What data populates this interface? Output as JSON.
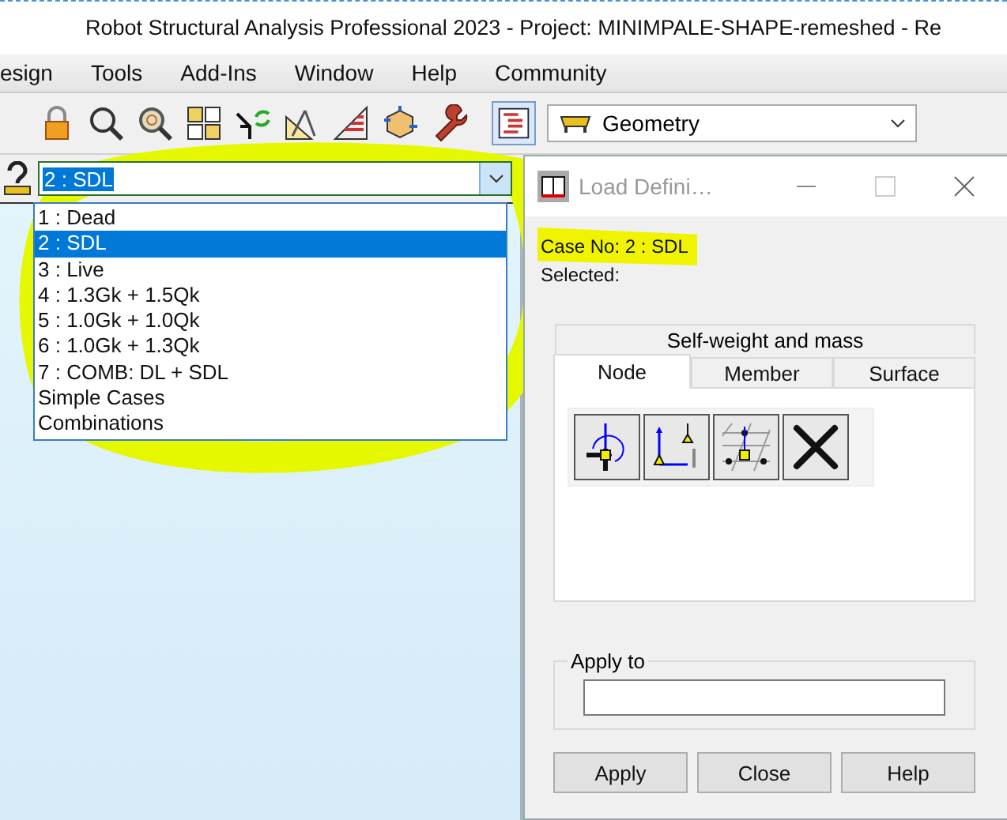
{
  "window": {
    "title": "Robot Structural Analysis Professional 2023 - Project: MINIMPALE-SHAPE-remeshed - Re"
  },
  "menu": [
    "esign",
    "Tools",
    "Add-Ins",
    "Window",
    "Help",
    "Community"
  ],
  "toolbar": {
    "layout_combo": "Geometry"
  },
  "load_case_combo": {
    "value": "2 : SDL",
    "options": [
      {
        "label": "1 : Dead",
        "selected": false
      },
      {
        "label": "2 : SDL",
        "selected": true
      },
      {
        "label": "3 : Live",
        "selected": false
      },
      {
        "label": "4 : 1.3Gk + 1.5Qk",
        "selected": false
      },
      {
        "label": "5 : 1.0Gk + 1.0Qk",
        "selected": false
      },
      {
        "label": "6 : 1.0Gk + 1.3Qk",
        "selected": false
      },
      {
        "label": "7 : COMB: DL + SDL",
        "selected": false
      },
      {
        "label": "Simple Cases",
        "selected": false
      },
      {
        "label": "Combinations",
        "selected": false
      }
    ]
  },
  "dialog": {
    "title": "Load Defini…",
    "case_no": "Case No: 2 : SDL",
    "selected_label": "Selected:",
    "tab_group": "Self-weight and mass",
    "tabs": [
      {
        "label": "Node",
        "selected": true
      },
      {
        "label": "Member",
        "selected": false
      },
      {
        "label": "Surface",
        "selected": false
      }
    ],
    "apply_to": {
      "label": "Apply to"
    },
    "buttons": [
      "Apply",
      "Close",
      "Help"
    ]
  }
}
